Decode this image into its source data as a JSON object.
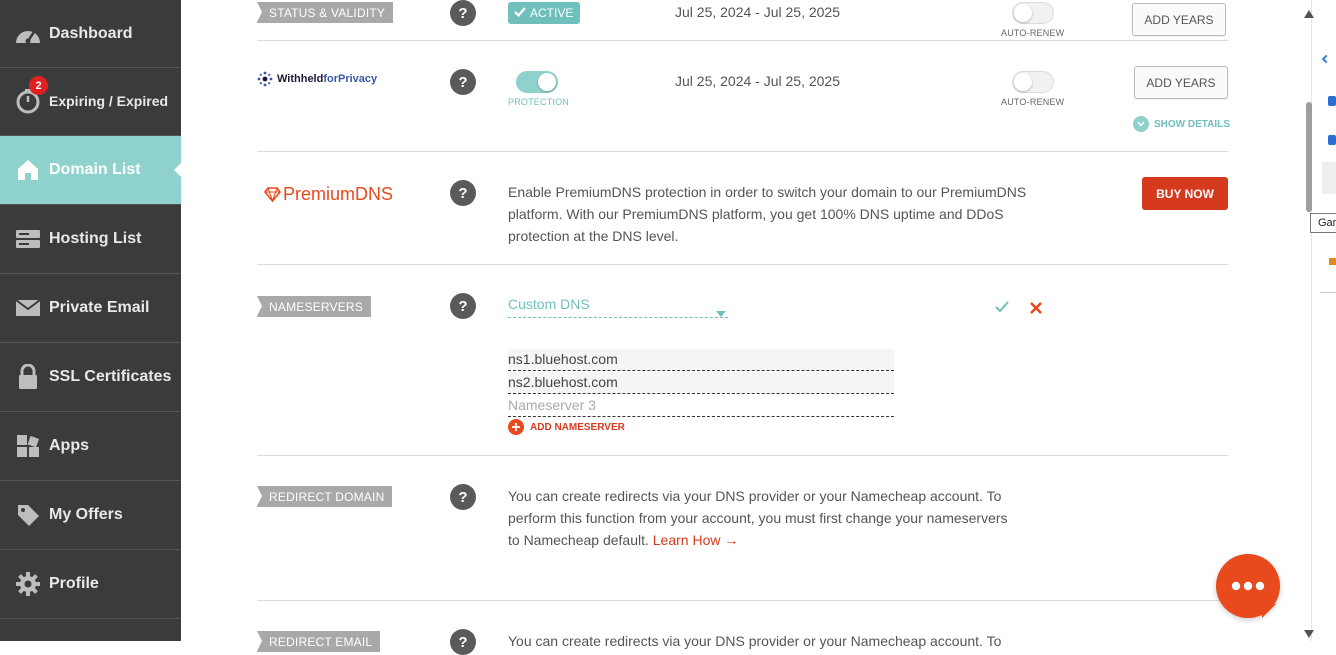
{
  "sidebar": {
    "items": [
      {
        "label": "Dashboard",
        "icon": "speedometer-icon"
      },
      {
        "label": "Expiring / Expired",
        "icon": "timer-icon",
        "badge": "2"
      },
      {
        "label": "Domain List",
        "icon": "home-icon",
        "active": true
      },
      {
        "label": "Hosting List",
        "icon": "server-icon"
      },
      {
        "label": "Private Email",
        "icon": "envelope-icon"
      },
      {
        "label": "SSL Certificates",
        "icon": "lock-icon"
      },
      {
        "label": "Apps",
        "icon": "apps-grid-icon"
      },
      {
        "label": "My Offers",
        "icon": "tag-icon"
      },
      {
        "label": "Profile",
        "icon": "gear-icon"
      }
    ]
  },
  "status": {
    "tag": "STATUS & VALIDITY",
    "badge": "ACTIVE",
    "dates": "Jul 25, 2024 - Jul 25, 2025",
    "auto_renew": "AUTO-RENEW",
    "add_years": "ADD YEARS"
  },
  "privacy": {
    "logo_text_bold": "Withheld",
    "logo_text_rest": "forPrivacy",
    "protection_label": "PROTECTION",
    "dates": "Jul 25, 2024 - Jul 25, 2025",
    "auto_renew": "AUTO-RENEW",
    "add_years": "ADD YEARS",
    "show_details": "SHOW DETAILS"
  },
  "premium_dns": {
    "logo_text": "PremiumDNS",
    "description": "Enable PremiumDNS protection in order to switch your domain to our PremiumDNS platform. With our PremiumDNS platform, you get 100% DNS uptime and DDoS protection at the DNS level.",
    "line1": "Enable PremiumDNS protection in order to switch your domain to our PremiumDNS",
    "line2": "platform. With our PremiumDNS platform, you get 100% DNS uptime and DDoS",
    "line3": "protection at the DNS level.",
    "buy_now": "BUY NOW"
  },
  "nameservers": {
    "tag": "NAMESERVERS",
    "selected": "Custom DNS",
    "ns1": "ns1.bluehost.com",
    "ns2": "ns2.bluehost.com",
    "ns3_placeholder": "Nameserver 3",
    "add": "ADD NAMESERVER"
  },
  "redirect_domain": {
    "tag": "REDIRECT DOMAIN",
    "line1": "You can create redirects via your DNS provider or your Namecheap account. To",
    "line2": "perform this function from your account, you must first change your nameservers",
    "line3": "to Namecheap default. ",
    "learn_how": "Learn How →"
  },
  "redirect_email": {
    "tag": "REDIRECT EMAIL",
    "line1": "You can create redirects via your DNS provider or your Namecheap account. To"
  },
  "help_label": "?",
  "tooltip_fragment": "Gar",
  "colors": {
    "sidebar_bg": "#3b3b3b",
    "active_teal": "#8fd1cd",
    "brand_orange": "#e8491d",
    "buy_red": "#d63a1e"
  }
}
